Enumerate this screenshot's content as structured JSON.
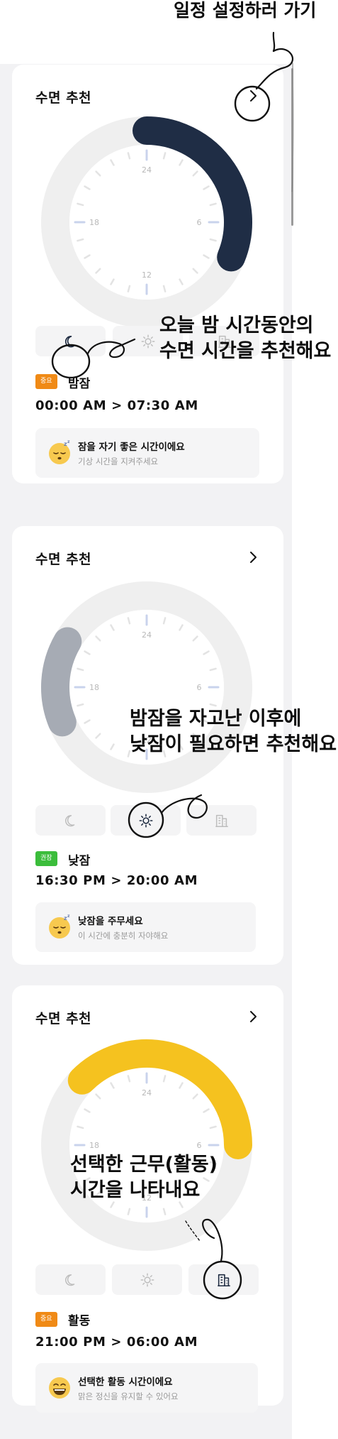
{
  "header": {
    "callout": "일정 설정하러 가기"
  },
  "cards": [
    {
      "title": "수면 추천",
      "badge": {
        "label": "중요",
        "color": "#f08a16"
      },
      "type_label": "밤잠",
      "time_range": "00:00  AM  >  07:30  AM",
      "info_title": "잠을 자기 좋은 시간이에요",
      "info_sub": "기상 시간을 지켜주세요",
      "active_mode": "night",
      "arc_color": "#1f2d45",
      "arc_hours": [
        0,
        7.5
      ]
    },
    {
      "title": "수면 추천",
      "badge": {
        "label": "권장",
        "color": "#3bbd3b"
      },
      "type_label": "낮잠",
      "time_range": "16:30  PM  >  20:00  AM",
      "info_title": "낮잠을 주무세요",
      "info_sub": "이 시간에 충분히 자야해요",
      "active_mode": "day",
      "arc_color": "#a6abb4",
      "arc_hours": [
        16.5,
        20
      ]
    },
    {
      "title": "수면 추천",
      "badge": {
        "label": "중요",
        "color": "#f08a16"
      },
      "type_label": "활동",
      "time_range": "21:00  PM  >  06:00  AM",
      "info_title": "선택한 활동 시간이에요",
      "info_sub": "맑은 정신을 유지할 수 있어요",
      "active_mode": "work",
      "arc_color": "#f5c21f",
      "arc_hours": [
        21,
        30
      ]
    }
  ],
  "clock_labels": [
    "24",
    "6",
    "12",
    "18"
  ],
  "annotations": {
    "a1_line1": "오늘 밤 시간동안의",
    "a1_line2": "수면 시간을 추천해요",
    "a2_line1": "밤잠을 자고난 이후에",
    "a2_line2": "낮잠이 필요하면 추천해요",
    "a3_line1": "선택한 근무(활동)",
    "a3_line2": "시간을 나타내요"
  },
  "icons": {
    "night": "moon-icon",
    "day": "sun-icon",
    "work": "building-icon",
    "chevron": "chevron-right-icon",
    "sleepy": "sleepy-face-icon",
    "happy": "laughing-face-icon"
  }
}
